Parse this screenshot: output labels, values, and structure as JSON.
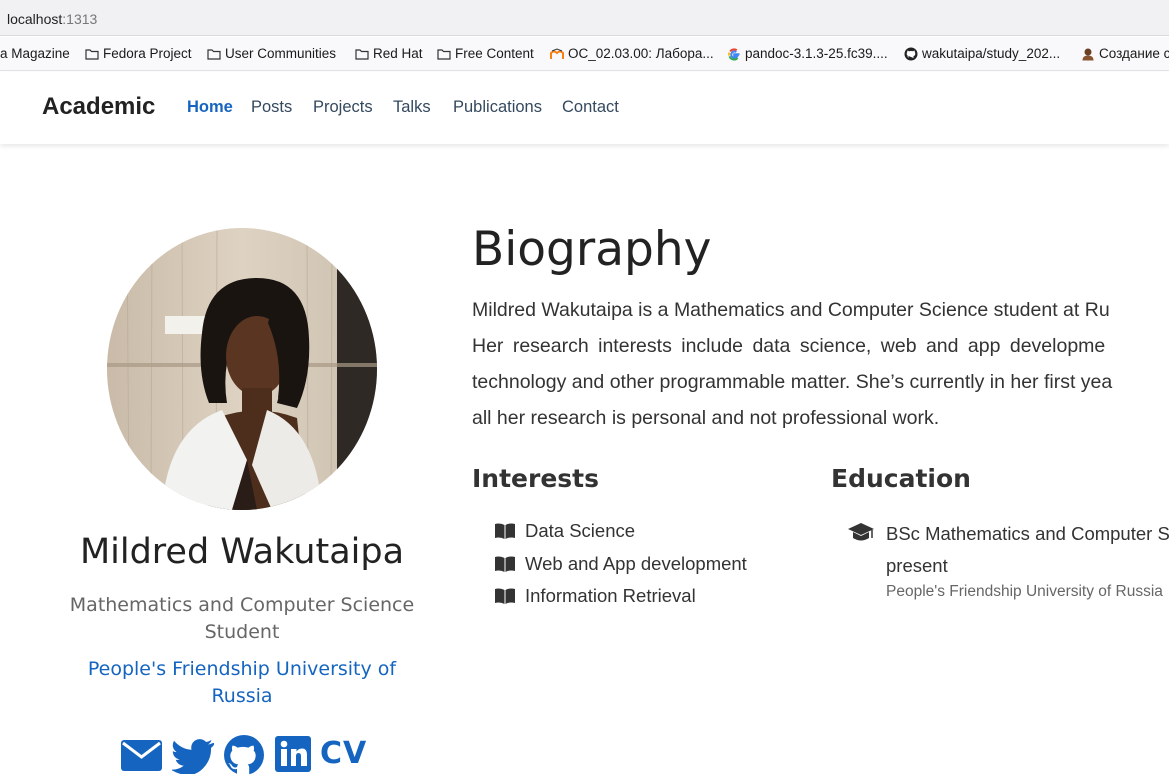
{
  "browser": {
    "url_host": "localhost",
    "url_port": ":1313"
  },
  "bookmarks": [
    {
      "label": "a Magazine",
      "icon": "none"
    },
    {
      "label": "Fedora Project",
      "icon": "folder-icon"
    },
    {
      "label": "User Communities",
      "icon": "folder-icon"
    },
    {
      "label": "Red Hat",
      "icon": "folder-icon"
    },
    {
      "label": "Free Content",
      "icon": "folder-icon"
    },
    {
      "label": "ОС_02.03.00: Лабора...",
      "icon": "moodle-icon"
    },
    {
      "label": "pandoc-3.1.3-25.fc39....",
      "icon": "google-icon"
    },
    {
      "label": "wakutaipa/study_202...",
      "icon": "github-icon"
    },
    {
      "label": "Создание с",
      "icon": "avatar-icon"
    }
  ],
  "navbar": {
    "brand": "Academic",
    "links": [
      "Home",
      "Posts",
      "Projects",
      "Talks",
      "Publications",
      "Contact"
    ],
    "active": "Home"
  },
  "profile": {
    "name": "Mildred Wakutaipa",
    "role": "Mathematics and Computer Science Student",
    "organization": "People's Friendship University of Russia",
    "social": [
      "envelope-icon",
      "twitter-icon",
      "github-icon",
      "linkedin-icon",
      "cv-icon"
    ],
    "cv_label": "CV"
  },
  "biography": {
    "title": "Biography",
    "lines": [
      "Mildred Wakutaipa is a Mathematics and Computer Science student at Ru",
      "Her research interests include data science, web and app developme",
      "technology and other programmable matter. She’s currently in her first yea",
      "all her research is personal and not professional work."
    ]
  },
  "interests": {
    "title": "Interests",
    "items": [
      "Data Science",
      "Web and App development",
      "Information Retrieval"
    ]
  },
  "education": {
    "title": "Education",
    "course_line1": "BSc Mathematics and Computer S",
    "course_line2": "present",
    "institution": "People's Friendship University of Russia"
  },
  "colors": {
    "accent": "#1565c0",
    "text": "#333333",
    "muted": "#666666"
  }
}
